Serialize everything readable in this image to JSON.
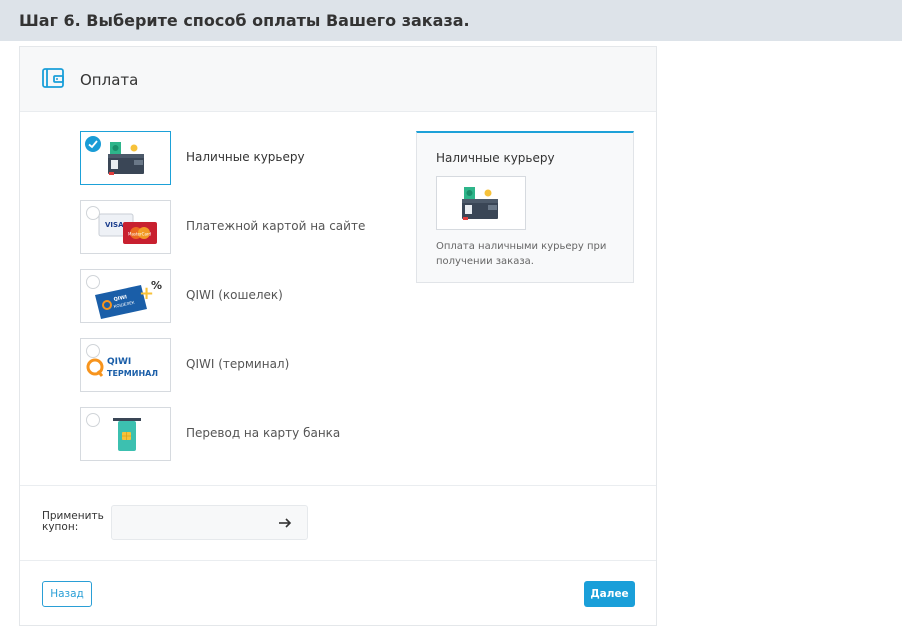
{
  "step_header": {
    "title": "Шаг 6. Выберите способ оплаты Вашего заказа."
  },
  "panel": {
    "title": "Оплата",
    "title_icon": "wallet-icon"
  },
  "payment_options": [
    {
      "id": "cash",
      "label": "Наличные курьеру",
      "selected": true,
      "icon": "cash-wallet-icon"
    },
    {
      "id": "card",
      "label": "Платежной картой на сайте",
      "selected": false,
      "icon": "visa-mastercard-icon"
    },
    {
      "id": "qiwi-wallet",
      "label": "QIWI (кошелек)",
      "selected": false,
      "icon": "qiwi-wallet-icon"
    },
    {
      "id": "qiwi-terminal",
      "label": "QIWI (терминал)",
      "selected": false,
      "icon": "qiwi-terminal-icon"
    },
    {
      "id": "bank-transfer",
      "label": "Перевод на карту банка",
      "selected": false,
      "icon": "bank-card-icon"
    }
  ],
  "info_card": {
    "title": "Наличные курьеру",
    "description": "Оплата наличными курьеру при получении заказа."
  },
  "coupon": {
    "label": "Применить купон:",
    "value": "",
    "placeholder": ""
  },
  "buttons": {
    "back_label": "Назад",
    "next_label": "Далее"
  },
  "logo_text": {
    "visa": "VISA",
    "mastercard": "MasterCard",
    "qiwi": "QIWI",
    "qiwi_wallet_sub": "КОШЕЛЕК",
    "terminal": "ТЕРМИНАЛ",
    "plus_sign": "+",
    "percent_sign": "%"
  },
  "colors": {
    "accent": "#1a9fd9",
    "header_bg": "#dde3e9",
    "qiwi_orange": "#f7941d",
    "qiwi_blue": "#1a5ea8"
  }
}
